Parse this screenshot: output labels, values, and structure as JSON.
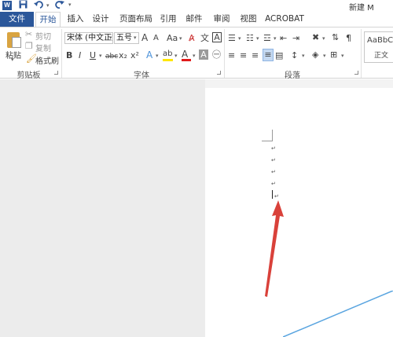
{
  "app": {
    "doc_title": "新建 M"
  },
  "quick_access": {
    "word_logo": "W",
    "save_icon": "save-icon",
    "undo_icon": "undo-icon",
    "redo_icon": "redo-icon",
    "more_icon": "customize-icon"
  },
  "tabs": [
    "文件",
    "开始",
    "插入",
    "设计",
    "页面布局",
    "引用",
    "邮件",
    "审阅",
    "视图",
    "ACROBAT"
  ],
  "clipboard": {
    "paste": "粘贴",
    "cut": "剪切",
    "copy": "复制",
    "format_painter": "格式刷",
    "label": "剪贴板"
  },
  "font": {
    "name": "宋体 (中文正文",
    "size": "五号",
    "grow": "A",
    "shrink": "A",
    "case": "Aa",
    "bold": "B",
    "italic": "I",
    "underline": "U",
    "strike": "abc",
    "subscript": "x₂",
    "superscript": "x²",
    "text_effect": "A",
    "highlight": "ab",
    "font_color": "A",
    "char_shading": "A",
    "char_border": "A",
    "label": "字体"
  },
  "paragraph": {
    "label": "段落"
  },
  "styles": {
    "preview": "AaBbCc",
    "name": "正文"
  },
  "document": {
    "paragraph_mark": "↵"
  },
  "colors": {
    "accent": "#2b579a",
    "arrow": "#d9413a",
    "highlight": "#ffe600",
    "font_color": "#e01a1a"
  }
}
